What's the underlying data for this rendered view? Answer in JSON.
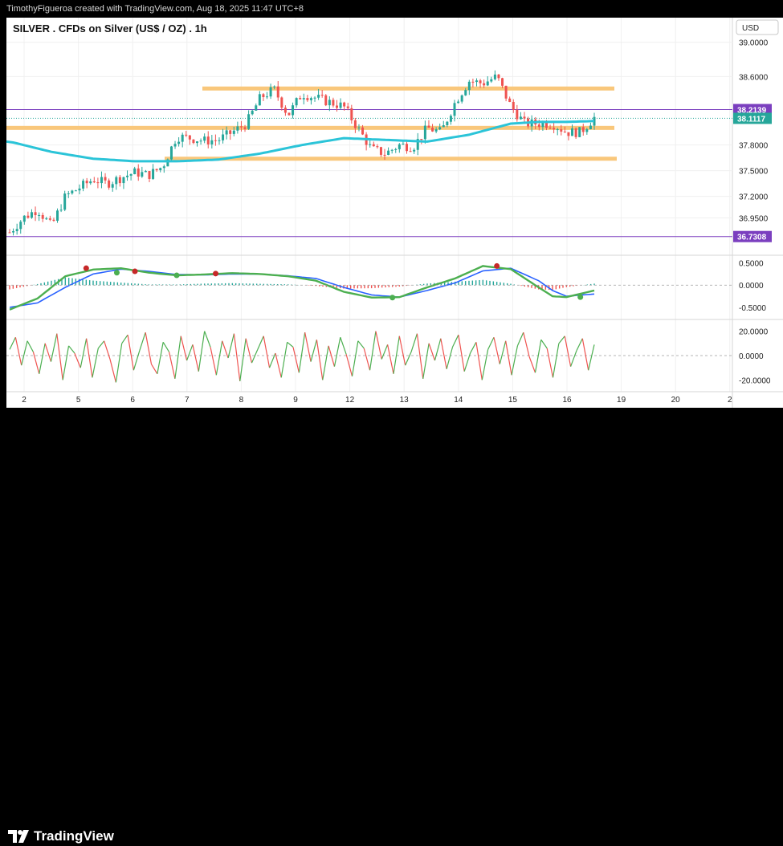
{
  "header_text": "TimothyFigueroa created with TradingView.com, Aug 18, 2025 11:47 UTC+8",
  "brand": "TradingView",
  "colors": {
    "up": "#26a69a",
    "down": "#ef5350",
    "ma": "#2bc4d8",
    "zone": "#f9c77b",
    "purple": "#7b3fbf",
    "macd": "#4caf50",
    "signal": "#2962ff",
    "macd_red": "#c62828",
    "rsi_up": "#4caf50",
    "rsi_down": "#ef5350"
  },
  "chart_data": [
    {
      "type": "candlestick",
      "title": "SILVER . CFDs on Silver (US$ / OZ) . 1h",
      "currency": "USD",
      "ylim": [
        36.55,
        39.25
      ],
      "y_ticks": [
        "39.0000",
        "38.6000",
        "37.8000",
        "37.5000",
        "37.2000",
        "36.9500"
      ],
      "y_tick_values": [
        39.0,
        38.6,
        37.8,
        37.5,
        37.2,
        36.95
      ],
      "x_tick_labels": [
        "2",
        "5",
        "6",
        "7",
        "8",
        "9",
        "12",
        "13",
        "14",
        "15",
        "16",
        "19",
        "20",
        "2"
      ],
      "price_labels": [
        {
          "text": "38.2139",
          "value": 38.2139,
          "color": "#7b3fbf"
        },
        {
          "text": "38.1117",
          "value": 38.1117,
          "color": "#26a69a"
        },
        {
          "text": "36.7308",
          "value": 36.7308,
          "color": "#7b3fbf"
        }
      ],
      "horizontal_lines": [
        {
          "value": 38.2139,
          "color": "#7b3fbf",
          "style": "solid"
        },
        {
          "value": 36.7308,
          "color": "#7b3fbf",
          "style": "solid"
        },
        {
          "value": 38.1117,
          "color": "#26a69a",
          "style": "dotted"
        }
      ],
      "zones": [
        {
          "value": 38.46
        },
        {
          "value": 38.0
        },
        {
          "value": 37.64
        }
      ],
      "close_path": [
        [
          0,
          36.78
        ],
        [
          1,
          36.95
        ],
        [
          2,
          37.05
        ],
        [
          3,
          36.85
        ],
        [
          4,
          37.2
        ],
        [
          5,
          37.3
        ],
        [
          6,
          37.4
        ],
        [
          7,
          37.35
        ],
        [
          8,
          37.42
        ],
        [
          9,
          37.48
        ],
        [
          10,
          37.45
        ],
        [
          11,
          37.55
        ],
        [
          12,
          37.9
        ],
        [
          13,
          37.88
        ],
        [
          14,
          37.85
        ],
        [
          15,
          37.86
        ],
        [
          16,
          37.95
        ],
        [
          17,
          38.05
        ],
        [
          18,
          38.35
        ],
        [
          19,
          38.45
        ],
        [
          20,
          38.15
        ],
        [
          21,
          38.4
        ],
        [
          22,
          38.35
        ],
        [
          23,
          38.3
        ],
        [
          24,
          38.25
        ],
        [
          25,
          38.0
        ],
        [
          26,
          37.75
        ],
        [
          27,
          37.7
        ],
        [
          28,
          37.8
        ],
        [
          29,
          37.78
        ],
        [
          30,
          38.0
        ],
        [
          31,
          37.95
        ],
        [
          32,
          38.3
        ],
        [
          33,
          38.55
        ],
        [
          34,
          38.52
        ],
        [
          35,
          38.6
        ],
        [
          36,
          38.25
        ],
        [
          37,
          38.05
        ],
        [
          38,
          38.05
        ],
        [
          39,
          38.05
        ],
        [
          40,
          37.95
        ],
        [
          41,
          37.95
        ],
        [
          42,
          38.12
        ]
      ],
      "moving_average": [
        [
          0,
          37.84
        ],
        [
          3,
          37.72
        ],
        [
          6,
          37.64
        ],
        [
          9,
          37.61
        ],
        [
          12,
          37.61
        ],
        [
          15,
          37.63
        ],
        [
          18,
          37.7
        ],
        [
          21,
          37.8
        ],
        [
          24,
          37.88
        ],
        [
          27,
          37.86
        ],
        [
          30,
          37.84
        ],
        [
          33,
          37.92
        ],
        [
          36,
          38.05
        ],
        [
          38,
          38.07
        ],
        [
          40,
          38.07
        ],
        [
          42,
          38.08
        ]
      ]
    },
    {
      "type": "macd",
      "ylim": [
        -0.7,
        0.6
      ],
      "y_ticks": [
        "0.5000",
        "0.0000",
        "-0.5000"
      ],
      "y_tick_values": [
        0.5,
        0.0,
        -0.5
      ],
      "macd": [
        [
          0,
          -0.55
        ],
        [
          2,
          -0.3
        ],
        [
          4,
          0.2
        ],
        [
          6,
          0.35
        ],
        [
          8,
          0.38
        ],
        [
          10,
          0.28
        ],
        [
          12,
          0.22
        ],
        [
          14,
          0.24
        ],
        [
          16,
          0.27
        ],
        [
          18,
          0.25
        ],
        [
          20,
          0.2
        ],
        [
          22,
          0.1
        ],
        [
          24,
          -0.15
        ],
        [
          26,
          -0.28
        ],
        [
          28,
          -0.27
        ],
        [
          30,
          -0.05
        ],
        [
          32,
          0.15
        ],
        [
          34,
          0.43
        ],
        [
          36,
          0.36
        ],
        [
          38,
          -0.05
        ],
        [
          39,
          -0.25
        ],
        [
          40,
          -0.27
        ],
        [
          42,
          -0.12
        ]
      ],
      "signal": [
        [
          0,
          -0.5
        ],
        [
          2,
          -0.4
        ],
        [
          4,
          -0.05
        ],
        [
          6,
          0.25
        ],
        [
          8,
          0.36
        ],
        [
          10,
          0.31
        ],
        [
          12,
          0.24
        ],
        [
          14,
          0.23
        ],
        [
          16,
          0.25
        ],
        [
          18,
          0.25
        ],
        [
          20,
          0.21
        ],
        [
          22,
          0.15
        ],
        [
          24,
          -0.05
        ],
        [
          26,
          -0.22
        ],
        [
          28,
          -0.27
        ],
        [
          30,
          -0.12
        ],
        [
          32,
          0.05
        ],
        [
          34,
          0.32
        ],
        [
          36,
          0.38
        ],
        [
          38,
          0.1
        ],
        [
          39,
          -0.12
        ],
        [
          40,
          -0.25
        ],
        [
          42,
          -0.2
        ]
      ],
      "cross_points": [
        {
          "x": 5.5,
          "value": 0.38,
          "color": "#c62828"
        },
        {
          "x": 7.7,
          "value": 0.28,
          "color": "#4caf50"
        },
        {
          "x": 9.0,
          "value": 0.31,
          "color": "#c62828"
        },
        {
          "x": 12.0,
          "value": 0.22,
          "color": "#4caf50"
        },
        {
          "x": 14.8,
          "value": 0.26,
          "color": "#c62828"
        },
        {
          "x": 27.5,
          "value": -0.28,
          "color": "#4caf50"
        },
        {
          "x": 35.0,
          "value": 0.43,
          "color": "#c62828"
        },
        {
          "x": 41.0,
          "value": -0.27,
          "color": "#4caf50"
        }
      ]
    },
    {
      "type": "oscillator",
      "ylim": [
        -27,
        27
      ],
      "y_ticks": [
        "20.0000",
        "0.0000",
        "-20.0000"
      ],
      "y_tick_values": [
        20,
        0,
        -20
      ],
      "values": [
        5,
        15,
        -8,
        12,
        3,
        -15,
        10,
        -5,
        18,
        -20,
        8,
        2,
        -10,
        14,
        -18,
        6,
        12,
        -3,
        -22,
        10,
        17,
        -12,
        4,
        19,
        -7,
        -15,
        11,
        3,
        -19,
        16,
        -4,
        9,
        -13,
        20,
        7,
        -16,
        12,
        -2,
        18,
        -21,
        14,
        -6,
        5,
        16,
        -10,
        2,
        -18,
        11,
        7,
        -14,
        19,
        -5,
        13,
        -20,
        8,
        -9,
        15,
        1,
        -17,
        12,
        6,
        -12,
        20,
        -3,
        9,
        -15,
        16,
        -8,
        3,
        18,
        -19,
        10,
        -4,
        14,
        -11,
        7,
        17,
        -13,
        2,
        11,
        -20,
        5,
        15,
        -7,
        12,
        -16,
        8,
        19,
        -1,
        -14,
        13,
        6,
        -18,
        10,
        16,
        -9,
        4,
        14,
        -12,
        9
      ]
    }
  ]
}
